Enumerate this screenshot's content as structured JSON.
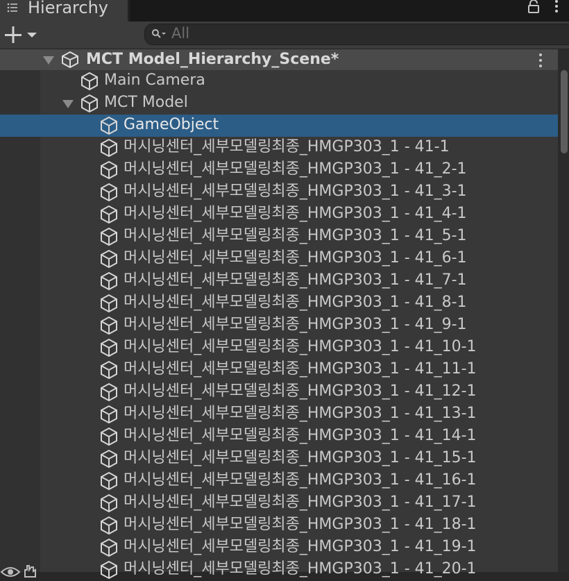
{
  "tab": {
    "title": "Hierarchy"
  },
  "search": {
    "placeholder": "All"
  },
  "scene": {
    "name": "MCT Model_Hierarchy_Scene*"
  },
  "rows": [
    {
      "label": "Main Camera"
    },
    {
      "label": "MCT Model"
    },
    {
      "label": "GameObject"
    },
    {
      "label": "머시닝센터_세부모델링최종_HMGP303_1 - 41-1"
    },
    {
      "label": "머시닝센터_세부모델링최종_HMGP303_1 - 41_2-1"
    },
    {
      "label": "머시닝센터_세부모델링최종_HMGP303_1 - 41_3-1"
    },
    {
      "label": "머시닝센터_세부모델링최종_HMGP303_1 - 41_4-1"
    },
    {
      "label": "머시닝센터_세부모델링최종_HMGP303_1 - 41_5-1"
    },
    {
      "label": "머시닝센터_세부모델링최종_HMGP303_1 - 41_6-1"
    },
    {
      "label": "머시닝센터_세부모델링최종_HMGP303_1 - 41_7-1"
    },
    {
      "label": "머시닝센터_세부모델링최종_HMGP303_1 - 41_8-1"
    },
    {
      "label": "머시닝센터_세부모델링최종_HMGP303_1 - 41_9-1"
    },
    {
      "label": "머시닝센터_세부모델링최종_HMGP303_1 - 41_10-1"
    },
    {
      "label": "머시닝센터_세부모델링최종_HMGP303_1 - 41_11-1"
    },
    {
      "label": "머시닝센터_세부모델링최종_HMGP303_1 - 41_12-1"
    },
    {
      "label": "머시닝센터_세부모델링최종_HMGP303_1 - 41_13-1"
    },
    {
      "label": "머시닝센터_세부모델링최종_HMGP303_1 - 41_14-1"
    },
    {
      "label": "머시닝센터_세부모델링최종_HMGP303_1 - 41_15-1"
    },
    {
      "label": "머시닝센터_세부모델링최종_HMGP303_1 - 41_16-1"
    },
    {
      "label": "머시닝센터_세부모델링최종_HMGP303_1 - 41_17-1"
    },
    {
      "label": "머시닝센터_세부모델링최종_HMGP303_1 - 41_18-1"
    },
    {
      "label": "머시닝센터_세부모델링최종_HMGP303_1 - 41_19-1"
    },
    {
      "label": "머시닝센터_세부모델링최종_HMGP303_1 - 41_20-1"
    }
  ],
  "icons": {
    "tab": "list-icon",
    "lock": "lock-icon",
    "menu": "kebab-menu-icon",
    "add": "plus-icon",
    "dropdown": "chevron-down-icon",
    "search": "search-icon",
    "scene": "unity-scene-icon",
    "object": "cube-icon",
    "expand": "triangle-down-icon",
    "visibility": "eye-icon",
    "pickability": "hand-icon"
  },
  "colors": {
    "selection": "#2c5d87",
    "panel": "#383838",
    "toolbar": "#3c3c3c"
  }
}
